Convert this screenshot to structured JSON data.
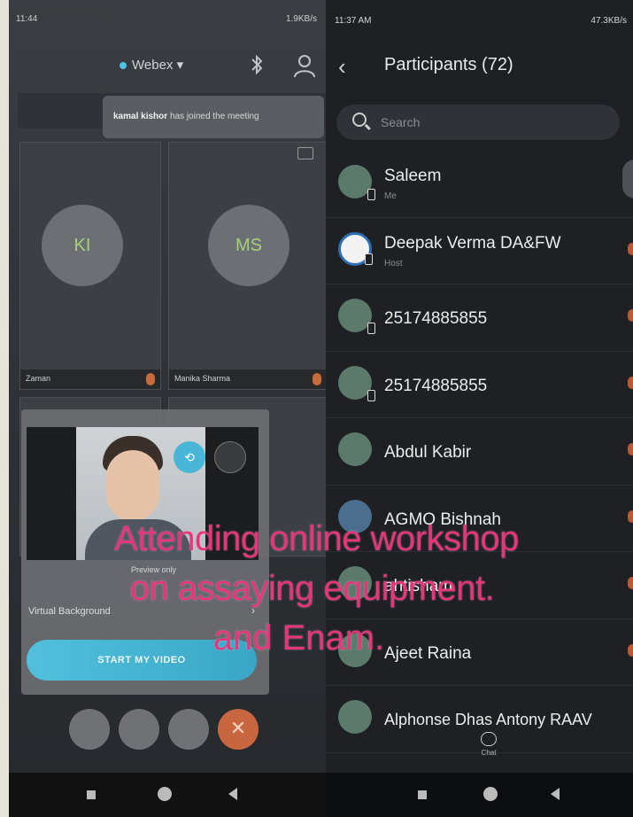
{
  "left_phone": {
    "status_time": "11:44",
    "status_right": "1.9KB/s",
    "app_title": "Webex",
    "toast": {
      "name": "kamal kishor",
      "text": "has joined the meeting"
    },
    "tiles": [
      {
        "initials": "KI",
        "name": "Zaman"
      },
      {
        "initials": "MS",
        "name": "Manika Sharma"
      }
    ],
    "preview": {
      "label": "Preview only",
      "virtual_background": "Virtual Background",
      "start_video": "START MY VIDEO"
    }
  },
  "right_phone": {
    "status_time": "11:37 AM",
    "status_right": "47.3KB/s",
    "title": "Participants (72)",
    "search_placeholder": "Search",
    "participants": [
      {
        "name": "Saleem",
        "role": "Me"
      },
      {
        "name": "Deepak Verma DA&FW",
        "role": "Host"
      },
      {
        "name": "25174885855",
        "role": ""
      },
      {
        "name": "25174885855",
        "role": ""
      },
      {
        "name": "Abdul Kabir",
        "role": ""
      },
      {
        "name": "AGMO Bishnah",
        "role": ""
      },
      {
        "name": "ahtisham",
        "role": ""
      },
      {
        "name": "Ajeet Raina",
        "role": ""
      },
      {
        "name": "Alphonse Dhas Antony RAAV",
        "role": ""
      }
    ],
    "chat_label": "Chat"
  },
  "caption": {
    "line1": "Attending online workshop",
    "line2": "on assaying equipment.",
    "line3": "and Enam."
  },
  "colors": {
    "caption": "#e8357a",
    "accent": "#48b6d6",
    "end_call": "#c8663f"
  }
}
